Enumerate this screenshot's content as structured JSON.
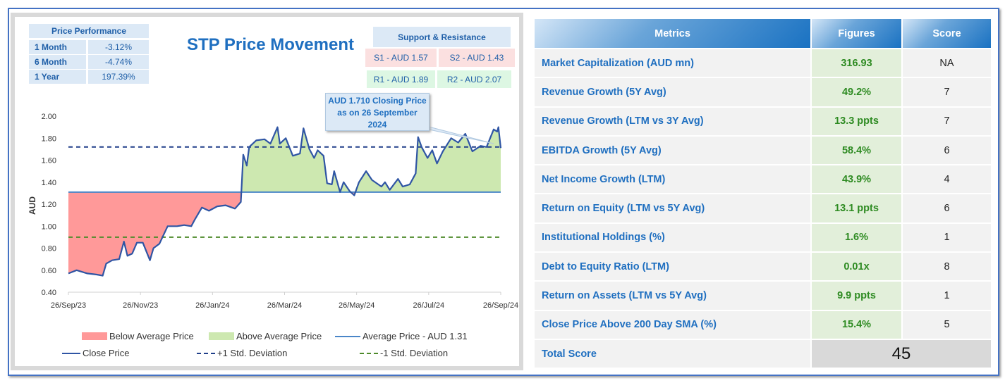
{
  "price_performance": {
    "title": "Price Performance",
    "rows": [
      {
        "label": "1 Month",
        "value": "-3.12%"
      },
      {
        "label": "6 Month",
        "value": "-4.74%"
      },
      {
        "label": "1 Year",
        "value": "197.39%"
      }
    ]
  },
  "support_resistance": {
    "title": "Support & Resistance",
    "s1": "S1 - AUD 1.57",
    "s2": "S2 - AUD 1.43",
    "r1": "R1 - AUD 1.89",
    "r2": "R2 - AUD 2.07"
  },
  "callout": {
    "line1": "AUD 1.710 Closing Price",
    "line2": "as on 26 September",
    "line3": "2024"
  },
  "chart_data": {
    "type": "area",
    "title": "STP Price Movement",
    "ylabel": "AUD",
    "ylim": [
      0.4,
      2.0
    ],
    "yticks": [
      "0.40",
      "0.60",
      "0.80",
      "1.00",
      "1.20",
      "1.40",
      "1.60",
      "1.80",
      "2.00"
    ],
    "xticks": [
      "26/Sep/23",
      "26/Nov/23",
      "26/Jan/24",
      "26/Mar/24",
      "26/May/24",
      "26/Jul/24",
      "26/Sep/24"
    ],
    "x_unit": "days since 26/Sep/23",
    "xlim": [
      0,
      366
    ],
    "average": 1.31,
    "plus_1sd": 1.72,
    "minus_1sd": 0.9,
    "legend": [
      "Below Average Price",
      "Above Average Price",
      "Average Price - AUD 1.31",
      "Close Price",
      "+1 Std. Deviation",
      "-1 Std. Deviation"
    ],
    "colors": {
      "below": "#ff9999",
      "above": "#cde8b0",
      "close": "#2f55a4",
      "avg": "#4a86c8",
      "plus": "#203f8a",
      "minus": "#4e8a2a"
    },
    "close_price": [
      [
        0,
        0.57
      ],
      [
        7,
        0.6
      ],
      [
        16,
        0.57
      ],
      [
        24,
        0.56
      ],
      [
        29,
        0.55
      ],
      [
        32,
        0.66
      ],
      [
        37,
        0.69
      ],
      [
        43,
        0.7
      ],
      [
        47,
        0.86
      ],
      [
        50,
        0.73
      ],
      [
        54,
        0.75
      ],
      [
        58,
        0.85
      ],
      [
        63,
        0.85
      ],
      [
        69,
        0.69
      ],
      [
        72,
        0.8
      ],
      [
        77,
        0.84
      ],
      [
        84,
        1.0
      ],
      [
        92,
        1.0
      ],
      [
        98,
        1.01
      ],
      [
        104,
        1.0
      ],
      [
        107,
        1.06
      ],
      [
        113,
        1.17
      ],
      [
        119,
        1.14
      ],
      [
        126,
        1.18
      ],
      [
        133,
        1.19
      ],
      [
        141,
        1.16
      ],
      [
        146,
        1.22
      ],
      [
        148,
        1.65
      ],
      [
        151,
        1.55
      ],
      [
        153,
        1.72
      ],
      [
        159,
        1.78
      ],
      [
        166,
        1.79
      ],
      [
        171,
        1.75
      ],
      [
        177,
        1.9
      ],
      [
        179,
        1.75
      ],
      [
        184,
        1.8
      ],
      [
        190,
        1.64
      ],
      [
        196,
        1.66
      ],
      [
        199,
        1.89
      ],
      [
        204,
        1.7
      ],
      [
        208,
        1.62
      ],
      [
        211,
        1.69
      ],
      [
        216,
        1.64
      ],
      [
        219,
        1.39
      ],
      [
        223,
        1.38
      ],
      [
        225,
        1.5
      ],
      [
        230,
        1.31
      ],
      [
        233,
        1.4
      ],
      [
        238,
        1.32
      ],
      [
        242,
        1.28
      ],
      [
        246,
        1.4
      ],
      [
        252,
        1.5
      ],
      [
        257,
        1.42
      ],
      [
        265,
        1.36
      ],
      [
        268,
        1.4
      ],
      [
        272,
        1.33
      ],
      [
        279,
        1.43
      ],
      [
        283,
        1.36
      ],
      [
        289,
        1.38
      ],
      [
        294,
        1.48
      ],
      [
        296,
        1.81
      ],
      [
        299,
        1.72
      ],
      [
        304,
        1.62
      ],
      [
        308,
        1.69
      ],
      [
        312,
        1.57
      ],
      [
        317,
        1.68
      ],
      [
        324,
        1.8
      ],
      [
        330,
        1.76
      ],
      [
        336,
        1.84
      ],
      [
        342,
        1.68
      ],
      [
        349,
        1.73
      ],
      [
        354,
        1.72
      ],
      [
        360,
        1.88
      ],
      [
        363,
        1.86
      ],
      [
        364,
        1.9
      ],
      [
        366,
        1.71
      ]
    ]
  },
  "table": {
    "headers": [
      "Metrics",
      "Figures",
      "Score"
    ],
    "rows": [
      [
        "Market Capitalization (AUD mn)",
        "316.93",
        "NA"
      ],
      [
        "Revenue Growth (5Y Avg)",
        "49.2%",
        "7"
      ],
      [
        "Revenue Growth (LTM vs 3Y Avg)",
        "13.3 ppts",
        "7"
      ],
      [
        "EBITDA Growth (5Y Avg)",
        "58.4%",
        "6"
      ],
      [
        "Net Income Growth (LTM)",
        "43.9%",
        "4"
      ],
      [
        "Return on Equity (LTM vs 5Y Avg)",
        "13.1 ppts",
        "6"
      ],
      [
        "Institutional Holdings (%)",
        "1.6%",
        "1"
      ],
      [
        "Debt to Equity Ratio (LTM)",
        "0.01x",
        "8"
      ],
      [
        "Return on Assets (LTM vs 5Y Avg)",
        "9.9 ppts",
        "1"
      ],
      [
        "Close Price Above 200 Day SMA (%)",
        "15.4%",
        "5"
      ]
    ],
    "total_label": "Total Score",
    "total_value": "45"
  }
}
